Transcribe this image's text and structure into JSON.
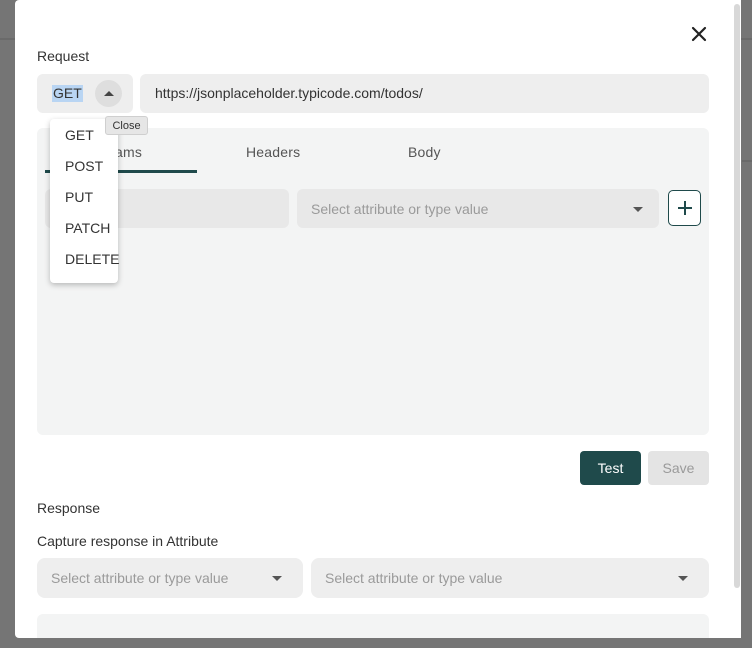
{
  "request": {
    "section_label": "Request",
    "method_value": "GET",
    "url_value": "https://jsonplaceholder.typicode.com/todos/"
  },
  "method_menu": {
    "options": [
      "GET",
      "POST",
      "PUT",
      "PATCH",
      "DELETE"
    ],
    "tooltip": "Close"
  },
  "tabs": {
    "params_fragment": "ams",
    "headers": "Headers",
    "body": "Body",
    "active_color": "#1f4a4b"
  },
  "params_row": {
    "value_placeholder": "Select attribute or type value"
  },
  "actions": {
    "test_label": "Test",
    "save_label": "Save",
    "test_color": "#1f4a4b"
  },
  "response": {
    "section_label": "Response",
    "capture_label": "Capture response in Attribute",
    "select_left_placeholder": "Select attribute or type value",
    "select_right_placeholder": "Select attribute or type value"
  },
  "icons": {
    "close": "close-icon",
    "caret_up": "caret-up-icon",
    "caret_down": "caret-down-icon",
    "plus": "plus-icon"
  }
}
